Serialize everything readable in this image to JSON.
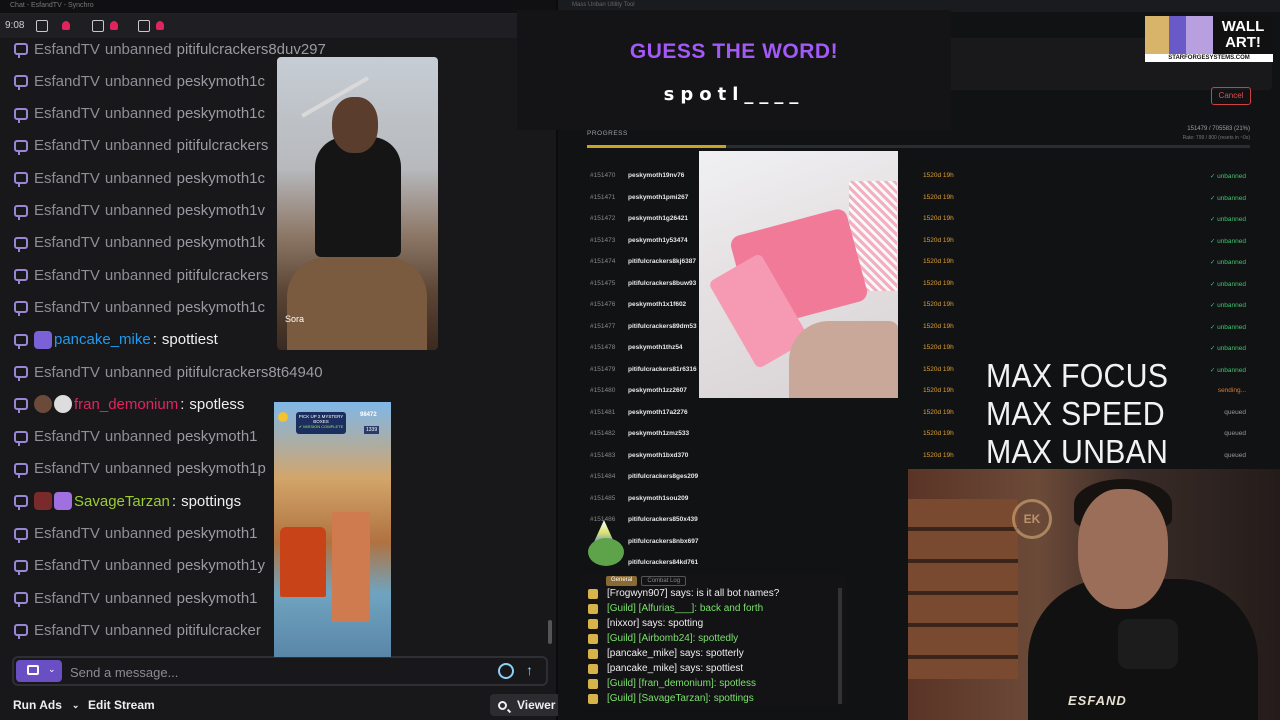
{
  "window": {
    "chat_title": "Chat - EsfandTV - Synchro",
    "tool_title": "Mass Unban Utility Tool"
  },
  "topbar": {
    "time": "9:08"
  },
  "chat": {
    "messages": [
      {
        "kind": "unban",
        "user": "EsfandTV",
        "verb": "unbanned",
        "target": "pitifulcrackers8duv297"
      },
      {
        "kind": "unban",
        "user": "EsfandTV",
        "verb": "unbanned",
        "target": "peskymoth1c"
      },
      {
        "kind": "unban",
        "user": "EsfandTV",
        "verb": "unbanned",
        "target": "peskymoth1c"
      },
      {
        "kind": "unban",
        "user": "EsfandTV",
        "verb": "unbanned",
        "target": "pitifulcrackers"
      },
      {
        "kind": "unban",
        "user": "EsfandTV",
        "verb": "unbanned",
        "target": "peskymoth1c"
      },
      {
        "kind": "unban",
        "user": "EsfandTV",
        "verb": "unbanned",
        "target": "peskymoth1v"
      },
      {
        "kind": "unban",
        "user": "EsfandTV",
        "verb": "unbanned",
        "target": "peskymoth1k"
      },
      {
        "kind": "unban",
        "user": "EsfandTV",
        "verb": "unbanned",
        "target": "pitifulcrackers"
      },
      {
        "kind": "unban",
        "user": "EsfandTV",
        "verb": "unbanned",
        "target": "peskymoth1c"
      },
      {
        "kind": "chat",
        "user": "pancake_mike",
        "color": "#1e9bf0",
        "text": "spottiest"
      },
      {
        "kind": "unban",
        "user": "EsfandTV",
        "verb": "unbanned",
        "target": "pitifulcrackers8t64940"
      },
      {
        "kind": "chat",
        "user": "fran_demonium",
        "color": "#e0245e",
        "text": "spotless"
      },
      {
        "kind": "unban",
        "user": "EsfandTV",
        "verb": "unbanned",
        "target": "peskymoth1"
      },
      {
        "kind": "unban",
        "user": "EsfandTV",
        "verb": "unbanned",
        "target": "peskymoth1p"
      },
      {
        "kind": "chat",
        "user": "SavageTarzan",
        "color": "#9acd32",
        "text": "spottings"
      },
      {
        "kind": "unban",
        "user": "EsfandTV",
        "verb": "unbanned",
        "target": "peskymoth1"
      },
      {
        "kind": "unban",
        "user": "EsfandTV",
        "verb": "unbanned",
        "target": "peskymoth1y"
      },
      {
        "kind": "unban",
        "user": "EsfandTV",
        "verb": "unbanned",
        "target": "peskymoth1"
      },
      {
        "kind": "unban",
        "user": "EsfandTV",
        "verb": "unbanned",
        "target": "pitifulcracker"
      }
    ],
    "input_placeholder": "Send a message...",
    "run_ads": "Run Ads",
    "edit_stream": "Edit Stream",
    "viewer": "Viewer"
  },
  "sora": {
    "label": "Sora"
  },
  "game": {
    "banner_line1": "PICK UP 2 MYSTERY",
    "banner_line2": "BOXES",
    "banner_status": "✔ MISSION COMPLETE",
    "score": "98472",
    "coins": "1339"
  },
  "guess": {
    "title": "GUESS THE WORD!",
    "word": "spotl____"
  },
  "tool": {
    "cancel": "Cancel",
    "progress_label": "PROGRESS",
    "progress_count": "151479 / 705583 (21%)",
    "progress_rate": "Rate: 799 / 800 (resets in ~0s)",
    "progress_fraction": 0.21,
    "rows": [
      {
        "id": "#151470",
        "name": "peskymoth19nv76",
        "dur": "1520d 19h",
        "status": "✓ unbanned",
        "state": "unbanned"
      },
      {
        "id": "#151471",
        "name": "peskymoth1pmi267",
        "dur": "1520d 19h",
        "status": "✓ unbanned",
        "state": "unbanned"
      },
      {
        "id": "#151472",
        "name": "peskymoth1g26421",
        "dur": "1520d 19h",
        "status": "✓ unbanned",
        "state": "unbanned"
      },
      {
        "id": "#151473",
        "name": "peskymoth1y53474",
        "dur": "1520d 19h",
        "status": "✓ unbanned",
        "state": "unbanned"
      },
      {
        "id": "#151474",
        "name": "pitifulcrackers8kj6387",
        "dur": "1520d 19h",
        "status": "✓ unbanned",
        "state": "unbanned"
      },
      {
        "id": "#151475",
        "name": "pitifulcrackers8buw93",
        "dur": "1520d 19h",
        "status": "✓ unbanned",
        "state": "unbanned"
      },
      {
        "id": "#151476",
        "name": "peskymoth1x1f602",
        "dur": "1520d 19h",
        "status": "✓ unbanned",
        "state": "unbanned"
      },
      {
        "id": "#151477",
        "name": "pitifulcrackers89dm53",
        "dur": "1520d 19h",
        "status": "✓ unbanned",
        "state": "unbanned"
      },
      {
        "id": "#151478",
        "name": "peskymoth1thz54",
        "dur": "1520d 19h",
        "status": "✓ unbanned",
        "state": "unbanned"
      },
      {
        "id": "#151479",
        "name": "pitifulcrackers81r6316",
        "dur": "1520d 19h",
        "status": "✓ unbanned",
        "state": "unbanned"
      },
      {
        "id": "#151480",
        "name": "peskymoth1zz2607",
        "dur": "1520d 19h",
        "status": "sending...",
        "state": "sending"
      },
      {
        "id": "#151481",
        "name": "peskymoth17a2276",
        "dur": "1520d 19h",
        "status": "queued",
        "state": "queued"
      },
      {
        "id": "#151482",
        "name": "peskymoth1zmz533",
        "dur": "1520d 19h",
        "status": "queued",
        "state": "queued"
      },
      {
        "id": "#151483",
        "name": "peskymoth1bxd370",
        "dur": "1520d 19h",
        "status": "queued",
        "state": "queued"
      },
      {
        "id": "#151484",
        "name": "pitifulcrackers8ges209",
        "dur": "",
        "status": "",
        "state": "queued"
      },
      {
        "id": "#151485",
        "name": "peskymoth1sou209",
        "dur": "",
        "status": "",
        "state": "queued"
      },
      {
        "id": "#151486",
        "name": "pitifulcrackers850x439",
        "dur": "",
        "status": "",
        "state": "queued"
      },
      {
        "id": "",
        "name": "pitifulcrackers8nbx697",
        "dur": "",
        "status": "",
        "state": "queued"
      },
      {
        "id": "",
        "name": "pitifulcrackers84kd761",
        "dur": "",
        "status": "",
        "state": "queued"
      }
    ]
  },
  "max_text": [
    "MAX FOCUS",
    "MAX SPEED",
    "MAX UNBAN"
  ],
  "wallart": {
    "title_1": "WALL",
    "title_2": "ART!",
    "sub": "STARFORGESYSTEMS.COM"
  },
  "webcam": {
    "logo": "EK",
    "shirt": "ESFAND"
  },
  "mini_chat": {
    "tab_general": "General",
    "tab_combat": "Combat Log",
    "lines": [
      {
        "type": "say",
        "text": "[Frogwyn907] says: is it all bot names?"
      },
      {
        "type": "guild",
        "text": "[Guild] [Alfurias___]: back and forth"
      },
      {
        "type": "say",
        "text": "[nixxor] says: spotting"
      },
      {
        "type": "guild",
        "text": "[Guild] [Airbomb24]: spottedly"
      },
      {
        "type": "say",
        "text": "[pancake_mike] says: spotterly"
      },
      {
        "type": "say",
        "text": "[pancake_mike] says: spottiest"
      },
      {
        "type": "guild",
        "text": "[Guild] [fran_demonium]: spotless"
      },
      {
        "type": "guild",
        "text": "[Guild] [SavageTarzan]: spottings"
      }
    ]
  }
}
